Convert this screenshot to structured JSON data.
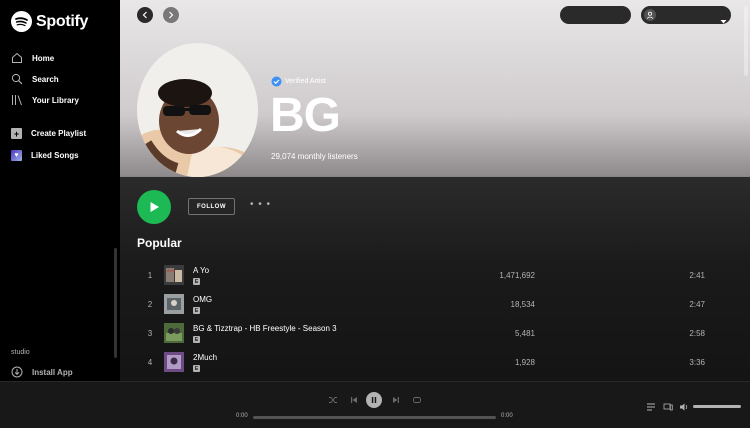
{
  "app": {
    "name": "Spotify"
  },
  "sidebar": {
    "nav": [
      {
        "label": "Home",
        "icon": "home-icon"
      },
      {
        "label": "Search",
        "icon": "search-icon"
      },
      {
        "label": "Your Library",
        "icon": "library-icon"
      }
    ],
    "actions": [
      {
        "label": "Create Playlist",
        "icon": "plus-icon"
      },
      {
        "label": "Liked Songs",
        "icon": "heart-icon"
      }
    ],
    "studio_label": "studio",
    "install_label": "Install App"
  },
  "artist": {
    "verified_label": "Verified Artist",
    "name": "BG",
    "listeners": "29,074 monthly listeners",
    "follow_label": "FOLLOW",
    "more_label": "• • •"
  },
  "popular": {
    "title": "Popular",
    "tracks": [
      {
        "num": "1",
        "title": "A Yo",
        "explicit": "E",
        "plays": "1,471,692",
        "duration": "2:41"
      },
      {
        "num": "2",
        "title": "OMG",
        "explicit": "E",
        "plays": "18,534",
        "duration": "2:47"
      },
      {
        "num": "3",
        "title": "BG & Tizztrap - HB Freestyle - Season 3",
        "explicit": "E",
        "plays": "5,481",
        "duration": "2:58"
      },
      {
        "num": "4",
        "title": "2Much",
        "explicit": "E",
        "plays": "1,928",
        "duration": "3:36"
      }
    ]
  },
  "player": {
    "elapsed": "0:00",
    "total": "0:00",
    "progress": 0
  },
  "colors": {
    "accent": "#1db954",
    "sidebar_bg": "#000000",
    "player_bg": "#181818"
  }
}
